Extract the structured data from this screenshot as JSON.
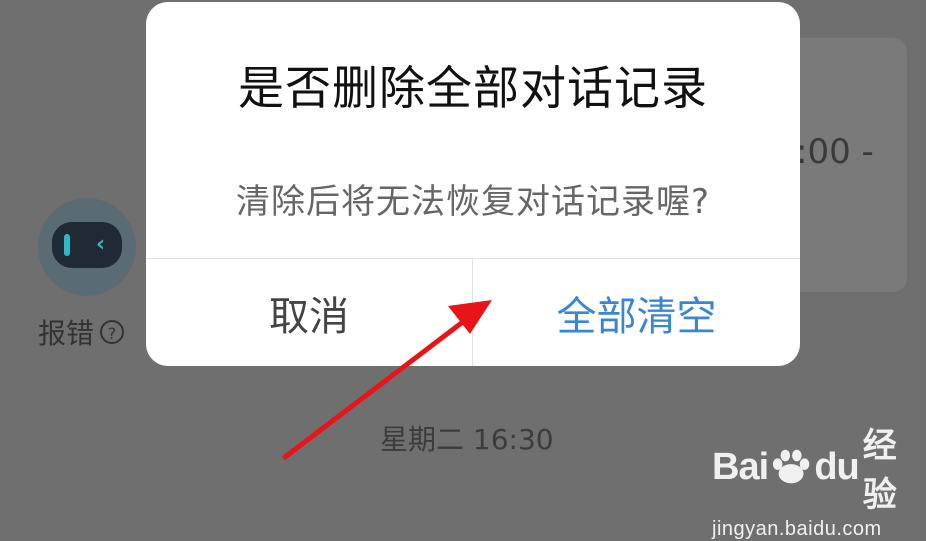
{
  "background": {
    "time_partial": ":00 -",
    "report_label": "报错",
    "report_help": "?",
    "timestamp": "星期二 16:30"
  },
  "dialog": {
    "title": "是否删除全部对话记录",
    "message": "清除后将无法恢复对话记录喔?",
    "cancel_label": "取消",
    "confirm_label": "全部清空"
  },
  "watermark": {
    "brand_left": "Bai",
    "brand_right": "du",
    "brand_cn": "经验",
    "url": "jingyan.baidu.com"
  },
  "colors": {
    "confirm": "#3a86d6",
    "arrow": "#e8141a",
    "overlay": "#6f6f6f"
  }
}
